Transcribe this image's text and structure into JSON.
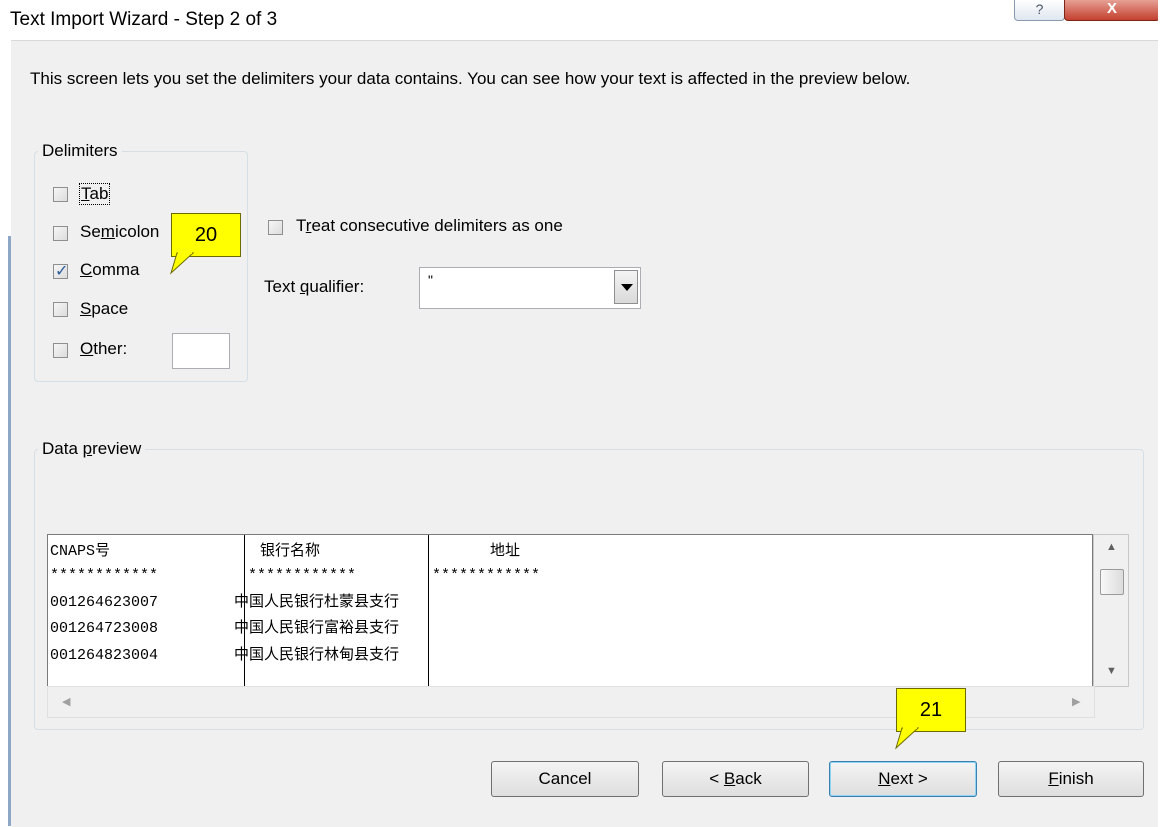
{
  "window": {
    "title": "Text Import Wizard - Step 2 of 3",
    "help_glyph": "?",
    "close_glyph": "X"
  },
  "description": "This screen lets you set the delimiters your data contains.  You can see how your text is affected in the preview below.",
  "delimiters": {
    "legend": "Delimiters",
    "tab": {
      "label": "Tab",
      "checked": false
    },
    "semicolon": {
      "label": "Semicolon",
      "checked": false
    },
    "comma": {
      "label": "Comma",
      "checked": true
    },
    "space": {
      "label": "Space",
      "checked": false
    },
    "other": {
      "label": "Other:",
      "checked": false,
      "value": ""
    }
  },
  "consecutive": {
    "label": "Treat consecutive delimiters as one",
    "checked": false
  },
  "qualifier": {
    "label": "Text qualifier:",
    "value": "\""
  },
  "preview": {
    "legend": "Data preview",
    "rows": [
      [
        "CNAPS号",
        "银行名称",
        "地址"
      ],
      [
        "************",
        "************",
        "************"
      ],
      [
        "001264623007",
        "中国人民银行杜蒙县支行",
        ""
      ],
      [
        "001264723008",
        "中国人民银行富裕县支行",
        ""
      ],
      [
        "001264823004",
        "中国人民银行林甸县支行",
        ""
      ]
    ]
  },
  "buttons": {
    "cancel": "Cancel",
    "back": "< Back",
    "next": "Next >",
    "finish": "Finish"
  },
  "callouts": {
    "c20": "20",
    "c21": "21"
  },
  "colors": {
    "callout": "#ffff00",
    "dialog_bg": "#f0f0f0",
    "close_button": "#c2402e"
  }
}
